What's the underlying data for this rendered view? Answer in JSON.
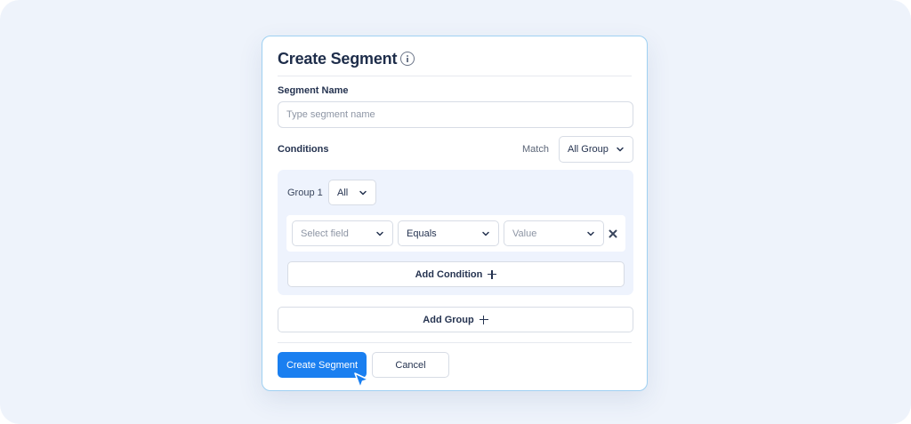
{
  "dialog": {
    "title": "Create Segment",
    "info_icon": "info-icon"
  },
  "segment_name": {
    "label": "Segment Name",
    "placeholder": "Type segment name",
    "value": ""
  },
  "conditions": {
    "label": "Conditions",
    "match_label": "Match",
    "match_value": "All Group"
  },
  "group": {
    "label": "Group 1",
    "operator_value": "All",
    "condition_row": {
      "field_placeholder": "Select field",
      "operator_value": "Equals",
      "value_placeholder": "Value",
      "remove_icon": "close-x-icon"
    },
    "add_condition_label": "Add Condition"
  },
  "add_group_label": "Add Group",
  "footer": {
    "primary_label": "Create Segment",
    "cancel_label": "Cancel"
  },
  "colors": {
    "primary": "#1a7ff0",
    "panel": "#eef3fd",
    "border_accent": "#9fd0f2"
  }
}
